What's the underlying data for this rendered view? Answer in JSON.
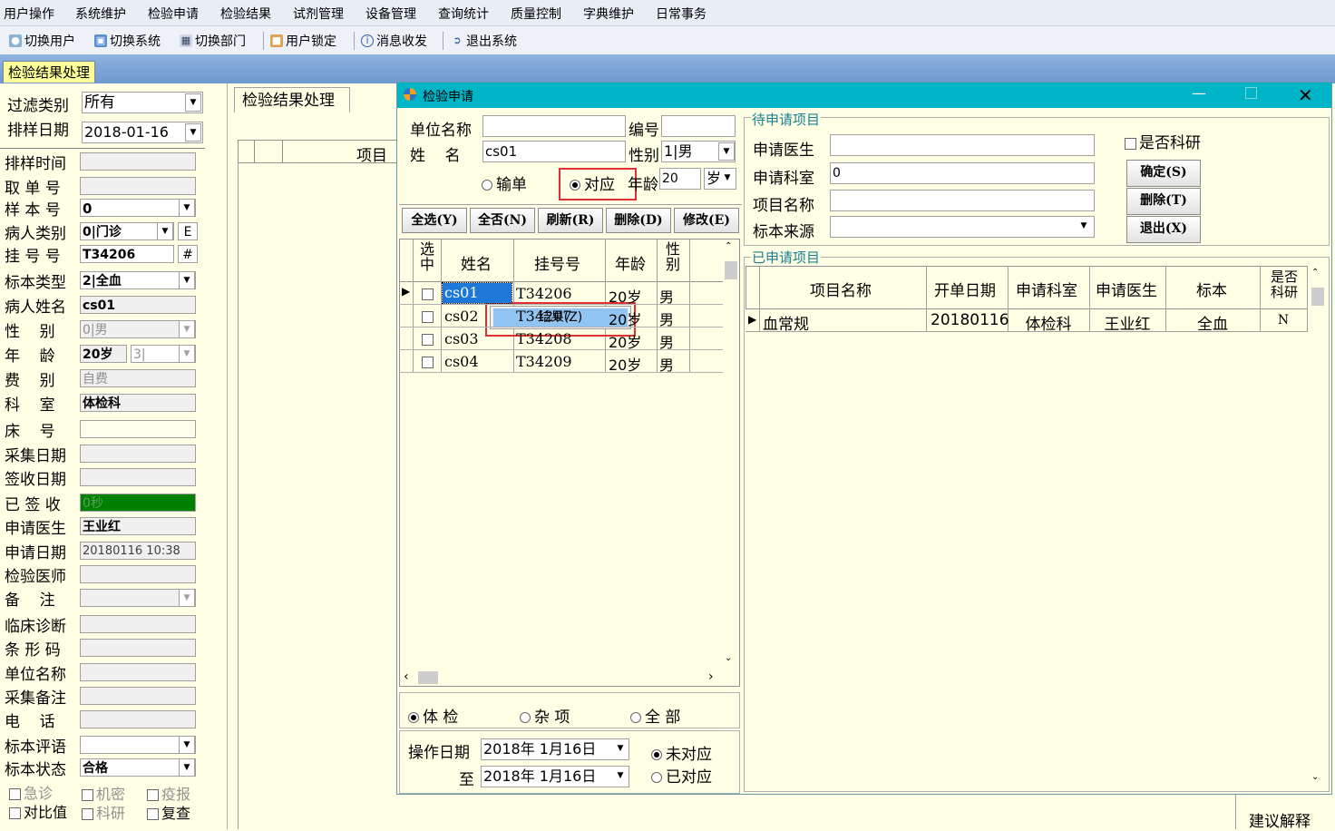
{
  "menubar": {
    "items": [
      "用户操作",
      "系统维护",
      "检验申请",
      "检验结果",
      "试剂管理",
      "设备管理",
      "查询统计",
      "质量控制",
      "字典维护",
      "日常事务"
    ]
  },
  "toolbar": {
    "switch_user": "切换用户",
    "switch_system": "切换系统",
    "switch_dept": "切换部门",
    "user_lock": "用户锁定",
    "messages": "消息收发",
    "exit": "退出系统"
  },
  "doc_tab": "检验结果处理",
  "left": {
    "filter_label": "过滤类别",
    "filter_value": "所有",
    "date_label": "排样日期",
    "date_value": "2018-01-16",
    "rows": [
      {
        "label": "排样时间",
        "value": ""
      },
      {
        "label": "取 单 号",
        "value": ""
      },
      {
        "label": "样 本 号",
        "value": "0"
      },
      {
        "label": "病人类别",
        "value": "0|门诊",
        "extra": "E"
      },
      {
        "label": "挂 号 号",
        "value": "T34206",
        "extra": "#"
      },
      {
        "label": "标本类型",
        "value": "2|全血"
      },
      {
        "label": "病人姓名",
        "value": "cs01"
      },
      {
        "label": "性    别",
        "value": "0|男"
      },
      {
        "label": "年    龄",
        "value": "20岁",
        "extra": "3|"
      },
      {
        "label": "费    别",
        "value": "自费"
      },
      {
        "label": "科    室",
        "value": "体检科"
      },
      {
        "label": "床    号",
        "value": ""
      },
      {
        "label": "采集日期",
        "value": ""
      },
      {
        "label": "签收日期",
        "value": ""
      },
      {
        "label": "已 签 收",
        "value": "0秒"
      },
      {
        "label": "申请医生",
        "value": "王业红"
      },
      {
        "label": "申请日期",
        "value": "20180116 10:38"
      },
      {
        "label": "检验医师",
        "value": ""
      },
      {
        "label": "备    注",
        "value": ""
      },
      {
        "label": "临床诊断",
        "value": ""
      },
      {
        "label": "条 形 码",
        "value": ""
      },
      {
        "label": "单位名称",
        "value": ""
      },
      {
        "label": "采集备注",
        "value": ""
      },
      {
        "label": "电    话",
        "value": ""
      },
      {
        "label": "标本评语",
        "value": ""
      },
      {
        "label": "标本状态",
        "value": "合格"
      }
    ],
    "checks": {
      "urgent": "急诊",
      "confidential": "机密",
      "epidemic": "疫报",
      "compare": "对比值",
      "research": "科研",
      "recheck": "复查"
    }
  },
  "mid": {
    "tab": "检验结果处理",
    "col": "项目"
  },
  "dialog": {
    "title": "检验申请",
    "company_label": "单位名称",
    "company_value": "",
    "code_label": "编号",
    "code_value": "",
    "name_label": "姓    名",
    "name_value": "cs01",
    "gender_label": "性别",
    "gender_value": "1|男",
    "radio_input": "输单",
    "radio_match": "对应",
    "age_label": "年龄",
    "age_value": "20",
    "age_unit": "岁",
    "buttons": {
      "select_all": "全选(Y)",
      "select_none": "全否(N)",
      "refresh": "刷新(R)",
      "delete": "删除(D)",
      "modify": "修改(E)"
    },
    "patients": {
      "headers": [
        "选中",
        "姓名",
        "挂号号",
        "年龄",
        "性别"
      ],
      "rows": [
        {
          "name": "cs01",
          "reg": "T34206",
          "age": "20岁",
          "sex": "男"
        },
        {
          "name": "cs02",
          "reg": "T34207",
          "age": "20岁",
          "sex": "男"
        },
        {
          "name": "cs03",
          "reg": "T34208",
          "age": "20岁",
          "sex": "男"
        },
        {
          "name": "cs04",
          "reg": "T34209",
          "age": "20岁",
          "sex": "男"
        }
      ]
    },
    "context_menu": "结果(Z)",
    "type_radios": {
      "checkup": "体 检",
      "misc": "杂 项",
      "all": "全 部"
    },
    "op_date_label": "操作日期",
    "op_date_value": "2018年 1月16日",
    "to_label": "至",
    "to_date_value": "2018年 1月16日",
    "match_radios": {
      "unmatched": "未对应",
      "matched": "已对应"
    },
    "pending": {
      "title": "待申请项目",
      "doctor_label": "申请医生",
      "doctor_value": "",
      "dept_label": "申请科室",
      "dept_value": "0",
      "item_label": "项目名称",
      "item_value": "",
      "source_label": "标本来源",
      "source_value": "",
      "research_label": "是否科研",
      "confirm": "确定(S)",
      "delete": "删除(T)",
      "exit": "退出(X)"
    },
    "applied": {
      "title": "已申请项目",
      "headers": [
        "项目名称",
        "开单日期",
        "申请科室",
        "申请医生",
        "标本",
        "是否科研"
      ],
      "rows": [
        {
          "item": "血常规",
          "date": "20180116",
          "dept": "体检科",
          "doctor": "王业红",
          "sample": "全血",
          "research": "N"
        }
      ]
    }
  },
  "bottom_right": {
    "label": "建议解释"
  }
}
